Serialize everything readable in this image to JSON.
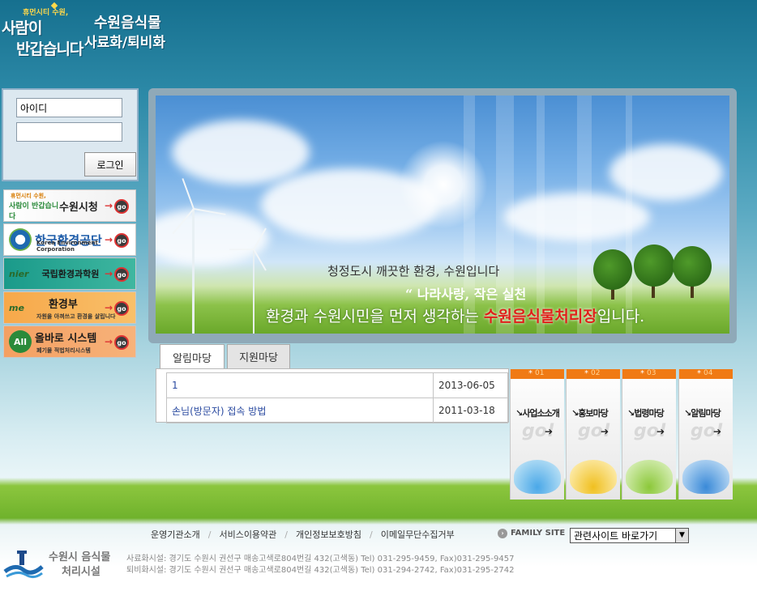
{
  "header": {
    "slogan_small": "휴먼시티 수원,",
    "slogan_line1": "사람이",
    "slogan_line2": "반갑습니다",
    "title_line1": "수원음식물",
    "title_line2": "사료화/퇴비화"
  },
  "login": {
    "id_placeholder": "아이디",
    "button_label": "로그인"
  },
  "banners": [
    {
      "title": "수원시청",
      "sub": "휴먼시티 수원,",
      "logo_text": "사람이 반갑습니다"
    },
    {
      "title": "한국환경공단",
      "sub": "Korea Environment Corporation"
    },
    {
      "title": "국립환경과학원",
      "logo_text": "nier"
    },
    {
      "title": "환경부",
      "logo_text": "me",
      "sub": "자원을 아껴쓰고 환경을 살립니다"
    },
    {
      "title": "올바로 시스템",
      "logo_text": "All",
      "sub": "폐기물 적법처리시스템"
    }
  ],
  "visual": {
    "line1": "청정도시 깨끗한 환경, 수원입니다",
    "line2": "“ 나라사랑, 작은 실천",
    "line3_pre": "환경과 수원시민을 먼저 생각하는 ",
    "line3_highlight": "수원음식물처리장",
    "line3_post": "입니다."
  },
  "tabs": [
    {
      "label": "알림마당"
    },
    {
      "label": "지원마당"
    }
  ],
  "board": [
    {
      "title": "1",
      "date": "2013-06-05"
    },
    {
      "title": "손님(방문자) 접속 방법",
      "date": "2011-03-18"
    }
  ],
  "quick_menu": [
    {
      "num": "01",
      "label": "사업소소개"
    },
    {
      "num": "02",
      "label": "홍보마당"
    },
    {
      "num": "03",
      "label": "법령마당"
    },
    {
      "num": "04",
      "label": "알림마당"
    }
  ],
  "quick_go": "go!",
  "footer": {
    "nav": [
      "운영기관소개",
      "서비스이용약관",
      "개인정보보호방침",
      "이메일무단수집거부"
    ],
    "family_site": "FAMILY SITE",
    "related_select": "관련사이트 바로가기",
    "org_line1": "수원시 음식물",
    "org_line2": "처리시설",
    "address1": "사료화시설: 경기도 수원시 권선구 매송고색로804번길 432(고색동)   Tel) 031-295-9459, Fax)031-295-9457",
    "address2": "퇴비화시설: 경기도 수원시 권선구 매송고색로804번길 432(고색동)   Tel) 031-294-2742, Fax)031-295-2742"
  }
}
